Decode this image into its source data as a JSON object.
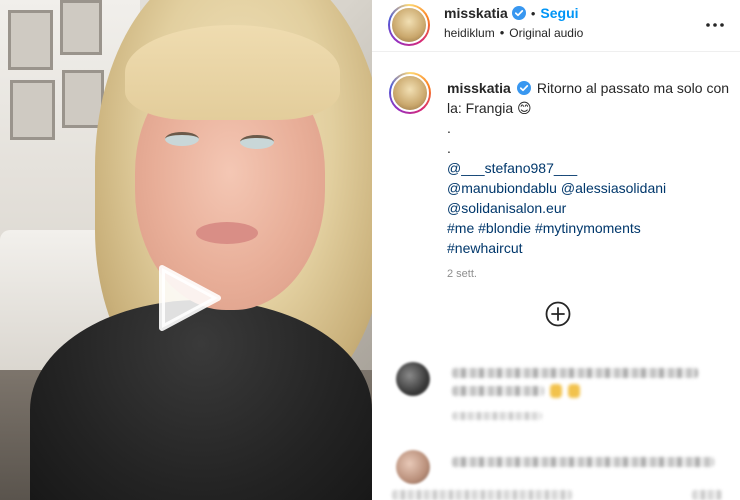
{
  "header": {
    "username": "misskatia",
    "follow_label": "Segui",
    "audio_artist": "heidiklum",
    "audio_label": "Original audio"
  },
  "caption": {
    "username": "misskatia",
    "text_line1": "Ritorno al passato ma solo con la: Frangia",
    "emoji": "😊",
    "dot1": ".",
    "dot2": ".",
    "mention1": "@___stefano987___",
    "mention2": "@manubiondablu",
    "mention3": "@alessiasolidani",
    "mention4": "@solidanisalon.eur",
    "hashtag1": "#me",
    "hashtag2": "#blondie",
    "hashtag3": "#mytinymoments",
    "hashtag4": "#newhaircut",
    "timestamp": "2 sett."
  },
  "icons": {
    "verified": "verified-badge-icon",
    "more": "more-options-icon",
    "load_more": "plus-circle-icon",
    "play": "play-icon"
  },
  "colors": {
    "link": "#00376b",
    "follow": "#0095f6",
    "verified": "#3897f0"
  }
}
